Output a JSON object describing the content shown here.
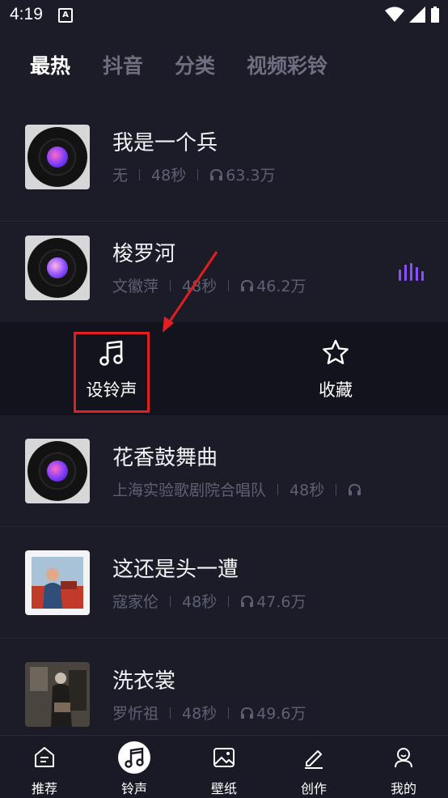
{
  "status_bar": {
    "time": "4:19",
    "notification_icon": "a-icon"
  },
  "tabs": [
    {
      "label": "最热",
      "active": true
    },
    {
      "label": "抖音",
      "active": false
    },
    {
      "label": "分类",
      "active": false
    },
    {
      "label": "视频彩铃",
      "active": false
    }
  ],
  "songs": [
    {
      "title": "我是一个兵",
      "artist": "无",
      "duration": "48秒",
      "plays": "63.3万",
      "cover": "vinyl"
    },
    {
      "title": "梭罗河",
      "artist": "文徽萍",
      "duration": "48秒",
      "plays": "46.2万",
      "cover": "vinyl-playing",
      "playing": true
    },
    {
      "title": "花香鼓舞曲",
      "artist": "上海实验歌剧院合唱队",
      "duration": "48秒",
      "plays": "",
      "cover": "vinyl"
    },
    {
      "title": "这还是头一遭",
      "artist": "寇家伦",
      "duration": "48秒",
      "plays": "47.6万",
      "cover": "photo"
    },
    {
      "title": "洗衣裳",
      "artist": "罗忻祖",
      "duration": "48秒",
      "plays": "49.6万",
      "cover": "photo"
    }
  ],
  "actions": {
    "set_ringtone": "设铃声",
    "favorite": "收藏"
  },
  "bottom_nav": [
    {
      "label": "推荐",
      "icon": "recommend-icon"
    },
    {
      "label": "铃声",
      "icon": "music-note-icon",
      "active": true
    },
    {
      "label": "壁纸",
      "icon": "wallpaper-icon"
    },
    {
      "label": "创作",
      "icon": "pen-icon"
    },
    {
      "label": "我的",
      "icon": "profile-icon"
    }
  ],
  "colors": {
    "accent": "#8a4dff",
    "highlight": "#e02020",
    "background": "#1c1c28"
  }
}
